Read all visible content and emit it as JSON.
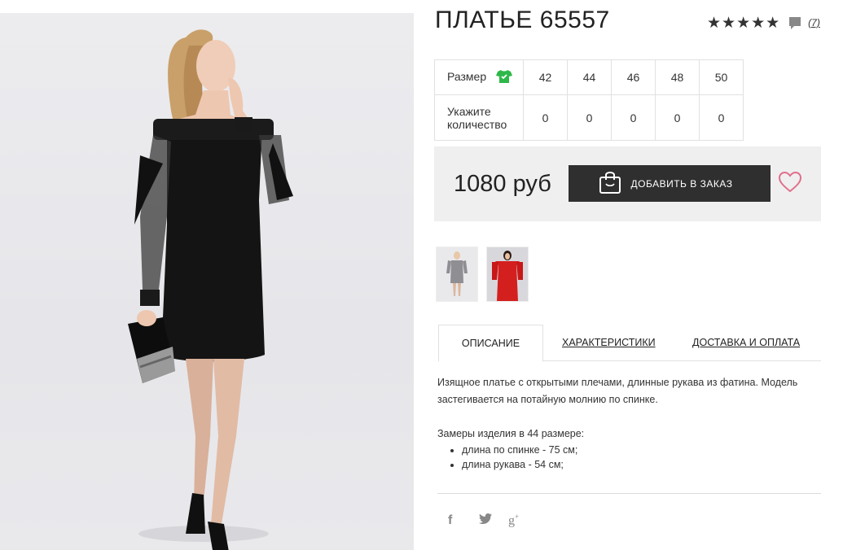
{
  "product": {
    "title": "ПЛАТЬЕ 65557",
    "rating_stars": "★★★★★",
    "review_count": "(7)"
  },
  "sizes": {
    "size_label": "Размер",
    "quantity_label": "Укажите количество",
    "columns": [
      "42",
      "44",
      "46",
      "48",
      "50"
    ],
    "quantities": [
      "0",
      "0",
      "0",
      "0",
      "0"
    ]
  },
  "buy": {
    "price": "1080 руб",
    "add_label": "ДОБАВИТЬ В ЗАКАЗ"
  },
  "tabs": [
    {
      "label": "ОПИСАНИЕ",
      "active": true
    },
    {
      "label": "ХАРАКТЕРИСТИКИ",
      "active": false
    },
    {
      "label": "ДОСТАВКА И ОПЛАТА",
      "active": false
    }
  ],
  "description": {
    "text": "Изящное платье с открытыми плечами, длинные рукава из фатина. Модель застегивается на потайную молнию по спинке.",
    "measures_title": "Замеры изделия в 44 размере:",
    "measures": [
      "длина по спинке - 75 см;",
      "длина рукава - 54 см;"
    ]
  },
  "icons": {
    "size_guide": "tshirt-icon",
    "comment": "comment-icon",
    "add_to_cart": "shopping-bag-icon",
    "wishlist": "heart-icon",
    "social": [
      "facebook-icon",
      "twitter-icon",
      "google-plus-icon"
    ]
  },
  "colors": {
    "accent_green": "#2fb84a",
    "button_bg": "#2f2f2f",
    "heart": "#e0708a",
    "buy_box_bg": "#efeff0"
  }
}
